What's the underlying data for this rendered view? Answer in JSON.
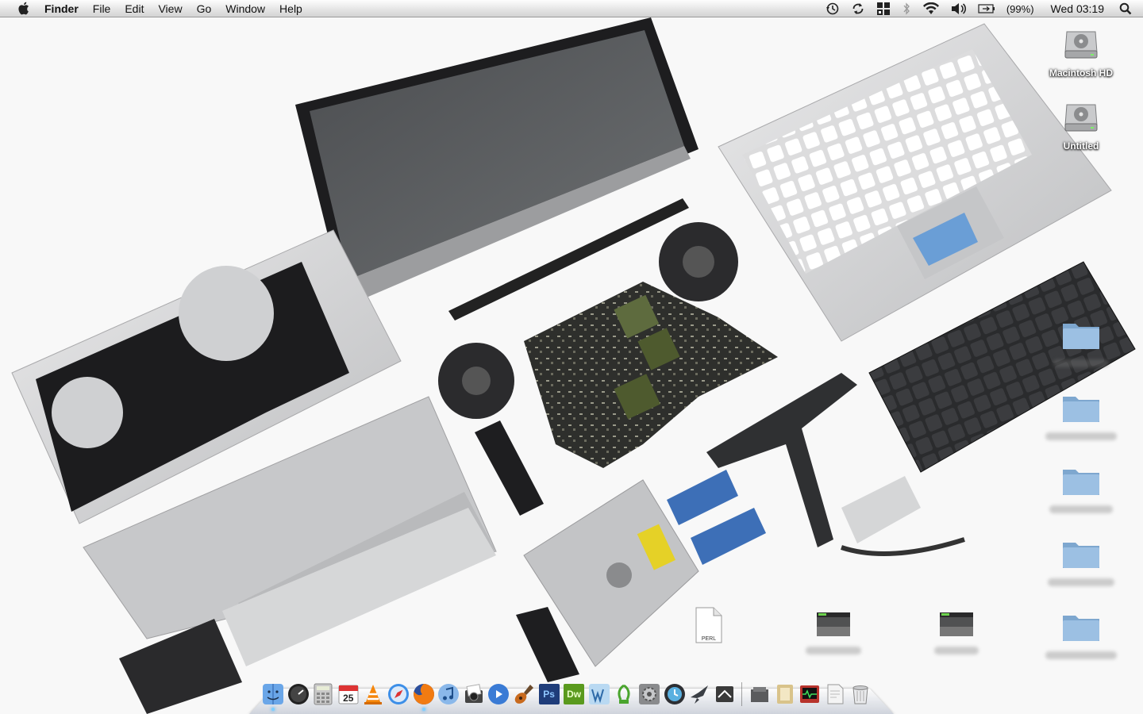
{
  "menubar": {
    "app_name": "Finder",
    "menus": [
      "File",
      "Edit",
      "View",
      "Go",
      "Window",
      "Help"
    ],
    "battery_percent": "(99%)",
    "clock": "Wed 03:19",
    "status_icons": [
      "time-machine-icon",
      "sync-icon",
      "spaces-icon",
      "bluetooth-icon",
      "wifi-icon",
      "volume-icon",
      "battery-icon",
      "spotlight-icon"
    ]
  },
  "desktop": {
    "icons": [
      {
        "label": "Macintosh HD",
        "type": "hard-drive"
      },
      {
        "label": "Untitled",
        "type": "hard-drive"
      },
      {
        "label": "",
        "type": "folder"
      },
      {
        "label": "",
        "type": "folder"
      },
      {
        "label": "",
        "type": "folder"
      },
      {
        "label": "",
        "type": "folder"
      },
      {
        "label": "",
        "type": "folder"
      },
      {
        "label": "PERL",
        "type": "document"
      },
      {
        "label": "",
        "type": "disk-image"
      },
      {
        "label": "",
        "type": "disk-image"
      }
    ]
  },
  "dock": {
    "apps": [
      "finder-icon",
      "dashboard-icon",
      "calculator-icon",
      "ical-icon",
      "vlc-icon",
      "safari-icon",
      "firefox-icon",
      "itunes-icon",
      "iphoto-icon",
      "imovie-icon",
      "garageband-icon",
      "photoshop-icon",
      "dreamweaver-icon",
      "wordpress-icon",
      "app-green-icon",
      "system-preferences-icon",
      "time-machine-dock-icon",
      "app-bird-icon",
      "app-ninja-icon"
    ],
    "photoshop_label": "Ps",
    "dreamweaver_label": "Dw",
    "ical_date": "25",
    "stacks": [
      "applications-stack-icon",
      "documents-stack-icon",
      "activity-monitor-icon",
      "downloads-stack-icon",
      "trash-icon"
    ]
  },
  "colors": {
    "menubar_top": "#fdfdfd",
    "folder_blue": "#8db3d8",
    "accent_blue": "#2f7ad8"
  }
}
